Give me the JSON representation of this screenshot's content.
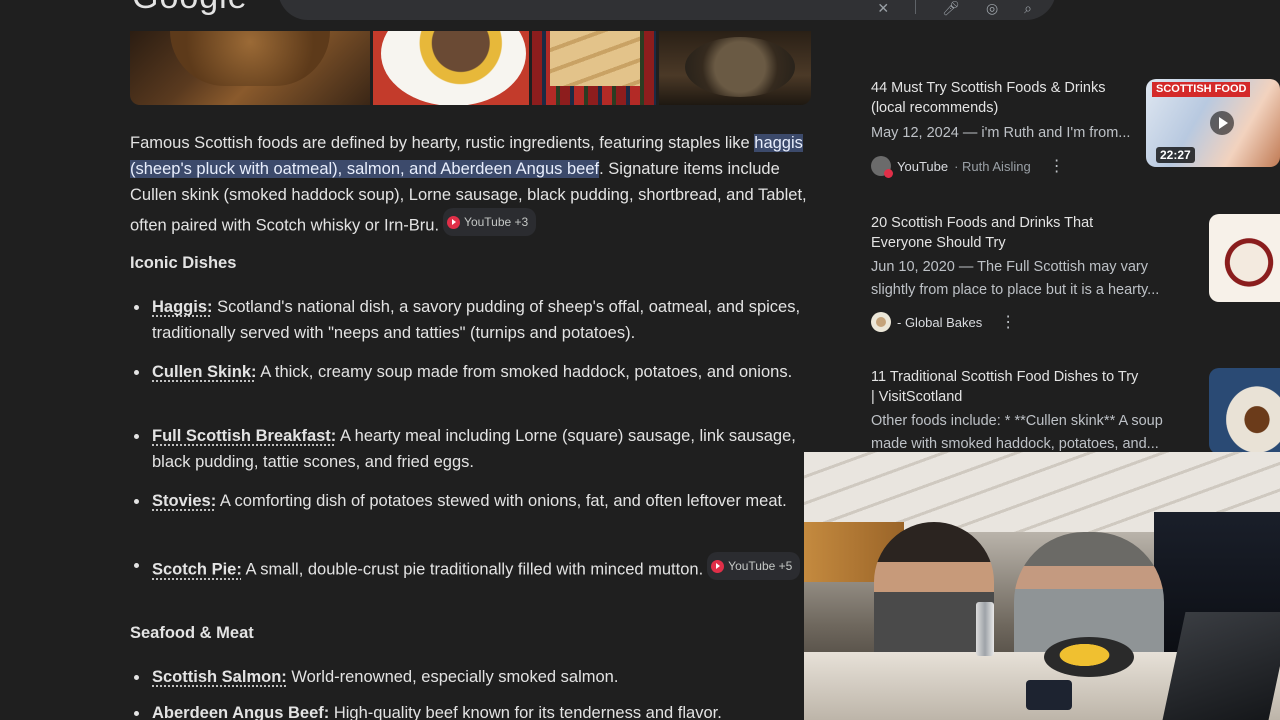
{
  "header": {
    "logo": "Google"
  },
  "images": [
    {
      "name": "haggis-photo"
    },
    {
      "name": "haggis-neeps-plate"
    },
    {
      "name": "shortbread-tartan"
    },
    {
      "name": "stew-pot"
    }
  ],
  "main": {
    "intro_before": "Famous Scottish foods are defined by hearty, rustic ingredients, featuring staples like ",
    "intro_highlight": "haggis (sheep's pluck with oatmeal), salmon, and Aberdeen Angus beef",
    "intro_after": ". Signature items include Cullen skink (smoked haddock soup), Lorne sausage, black pudding, shortbread, and Tablet, often paired with Scotch whisky or Irn-Bru.",
    "intro_chip": "YouTube +3",
    "iconic_heading": "Iconic Dishes",
    "seafood_heading": "Seafood & Meat",
    "bullets": [
      {
        "term": "Haggis:",
        "text": " Scotland's national dish, a savory pudding of sheep's offal, oatmeal, and spices, traditionally served with \"neeps and tatties\" (turnips and potatoes)."
      },
      {
        "term": "Cullen Skink:",
        "text": " A thick, creamy soup made from smoked haddock, potatoes, and onions."
      },
      {
        "term": "Full Scottish Breakfast:",
        "text": " A hearty meal including Lorne (square) sausage, link sausage, black pudding, tattie scones, and fried eggs."
      },
      {
        "term": "Stovies:",
        "text": " A comforting dish of potatoes stewed with onions, fat, and often leftover meat."
      },
      {
        "term": "Scotch Pie:",
        "text": " A small, double-crust pie traditionally filled with minced mutton.",
        "chip": "YouTube +5"
      },
      {
        "term": "Scottish Salmon:",
        "text": " World-renowned, especially smoked salmon."
      },
      {
        "term": "Aberdeen Angus Beef:",
        "text": " High-quality beef known for its tenderness and flavor."
      }
    ]
  },
  "sources": [
    {
      "title": "44 Must Try Scottish Foods & Drinks (local recommends)",
      "snippet": "May 12, 2024 — i'm Ruth and I'm from...",
      "site": "YouTube",
      "sub": "· Ruth Aisling",
      "thumb_badge": "SCOTTISH FOOD",
      "duration": "22:27"
    },
    {
      "title": "20 Scottish Foods and Drinks That Everyone Should Try",
      "snippet": "Jun 10, 2020 — The Full Scottish may vary slightly from place to place but it is a hearty...",
      "site": "- Global Bakes",
      "sub": ""
    },
    {
      "title": "11 Traditional Scottish Food Dishes to Try | VisitScotland",
      "snippet": "Other foods include: * **Cullen skink** A soup made with smoked haddock, potatoes, and..."
    }
  ],
  "colors": {
    "background": "#1f1f1f",
    "highlight": "#3c4a6b",
    "youtube_red": "#e02f48"
  }
}
